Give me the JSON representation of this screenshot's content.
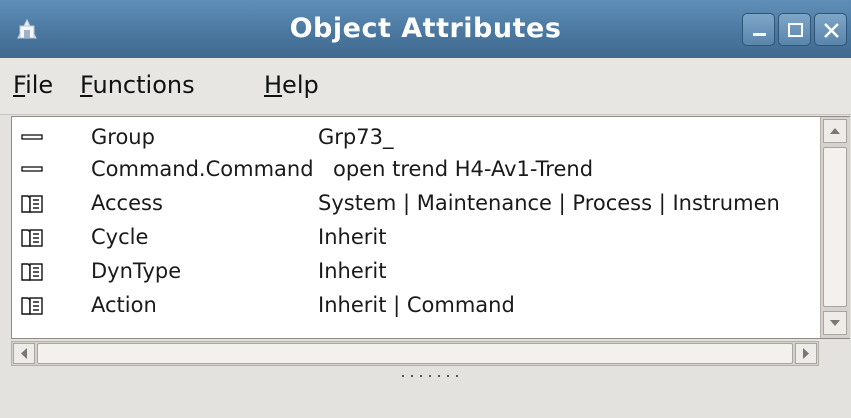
{
  "window": {
    "title": "Object Attributes",
    "app_icon": "app-icon",
    "controls": [
      "minimize-icon",
      "maximize-icon",
      "close-icon"
    ]
  },
  "menu": {
    "file": {
      "mnemonic": "F",
      "rest": "ile"
    },
    "functions": {
      "mnemonic": "F",
      "rest": "unctions"
    },
    "help": {
      "mnemonic": "H",
      "rest": "elp"
    }
  },
  "attributes": [
    {
      "icon": "attribute-icon",
      "name": "Group",
      "value": "Grp73_"
    },
    {
      "icon": "attribute-icon",
      "name": "Command.Command",
      "value": "open trend H4-Av1-Trend"
    },
    {
      "icon": "folder-icon",
      "name": "Access",
      "value": "System | Maintenance | Process | Instrumen"
    },
    {
      "icon": "folder-icon",
      "name": "Cycle",
      "value": "Inherit"
    },
    {
      "icon": "folder-icon",
      "name": "DynType",
      "value": "Inherit"
    },
    {
      "icon": "folder-icon",
      "name": "Action",
      "value": "Inherit | Command"
    }
  ]
}
